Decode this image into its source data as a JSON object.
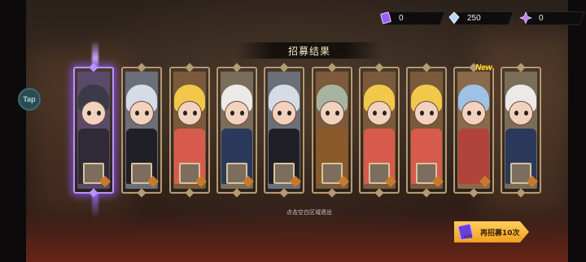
{
  "currencies": [
    {
      "icon": "purple-ticket-icon",
      "value": "0",
      "color": "#9b5cff"
    },
    {
      "icon": "crystal-icon",
      "value": "250",
      "color": "#b9d8ff"
    },
    {
      "icon": "purple-gem-icon",
      "value": "0",
      "color": "#c27cff"
    }
  ],
  "title": "招募结果",
  "tap_label": "Tap",
  "new_badge": "New",
  "cards": [
    {
      "rarity": "purple",
      "hair": "#3a3a4a",
      "body": "#2f2a36",
      "bg": "#5a4a6a"
    },
    {
      "rarity": "gold",
      "hair": "#d6dce6",
      "body": "#1f1f25",
      "bg": "#6c6f78"
    },
    {
      "rarity": "gold",
      "hair": "#f1c84a",
      "body": "#d65b4c",
      "bg": "#7a5a3a"
    },
    {
      "rarity": "gold",
      "hair": "#eceae6",
      "body": "#2b3a5a",
      "bg": "#7a6d5a"
    },
    {
      "rarity": "gold",
      "hair": "#d6dce6",
      "body": "#1f1f25",
      "bg": "#6c6f78"
    },
    {
      "rarity": "gold",
      "hair": "#a8b3a2",
      "body": "#8a5a2a",
      "bg": "#7d5a3a"
    },
    {
      "rarity": "gold",
      "hair": "#f1c84a",
      "body": "#d65b4c",
      "bg": "#7a5a3a"
    },
    {
      "rarity": "gold",
      "hair": "#f1c84a",
      "body": "#d65b4c",
      "bg": "#7a5a3a"
    },
    {
      "rarity": "gold",
      "hair": "#9ec1e6",
      "body": "#b0433a",
      "bg": "#8a6a4a"
    },
    {
      "rarity": "gold",
      "hair": "#eceae6",
      "body": "#2b3a5a",
      "bg": "#7a6d5a"
    }
  ],
  "hint": "点击空白区域退出",
  "recruit_button": {
    "label": "再招募10次",
    "cost": "x10"
  }
}
